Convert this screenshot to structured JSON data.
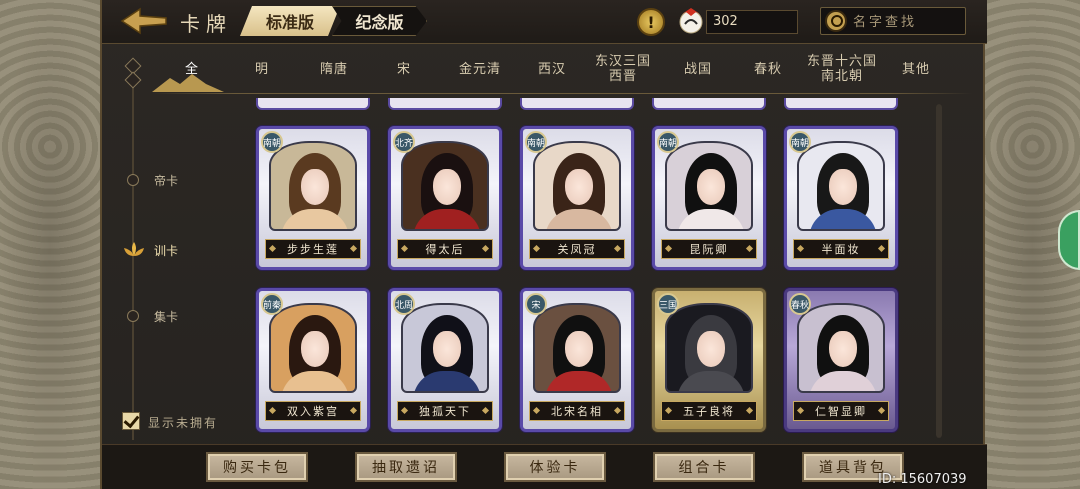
{
  "header": {
    "title": "卡牌",
    "tab_standard": "标准版",
    "tab_memorial": "纪念版",
    "currency_value": "302",
    "search_placeholder": "名字查找"
  },
  "dynasty_tabs": [
    {
      "label": "全",
      "active": true
    },
    {
      "label": "明",
      "active": false
    },
    {
      "label": "隋唐",
      "active": false
    },
    {
      "label": "宋",
      "active": false
    },
    {
      "label": "金元清",
      "active": false
    },
    {
      "label": "西汉",
      "active": false
    },
    {
      "label": "东汉三国西晋",
      "active": false
    },
    {
      "label": "战国",
      "active": false
    },
    {
      "label": "春秋",
      "active": false
    },
    {
      "label": "东晋十六国南北朝",
      "active": false
    },
    {
      "label": "其他",
      "active": false
    }
  ],
  "left_rail": {
    "items": [
      {
        "label": "帝卡",
        "active": false
      },
      {
        "label": "训卡",
        "active": true
      },
      {
        "label": "集卡",
        "active": false
      }
    ],
    "show_unowned_label": "显示未拥有",
    "show_unowned_checked": true
  },
  "cards": [
    {
      "name": "步步生莲",
      "badge": "南朝",
      "frame": "silver",
      "hair": "#5a3a20",
      "robe": "#e8c8a0",
      "bg": "#c8b898"
    },
    {
      "name": "得太后",
      "badge": "北齐",
      "frame": "silver",
      "hair": "#1a1010",
      "robe": "#a02020",
      "bg": "#4a3020"
    },
    {
      "name": "关凤冠",
      "badge": "南朝",
      "frame": "silver",
      "hair": "#3a2418",
      "robe": "#d8b8a0",
      "bg": "#e8d8c8"
    },
    {
      "name": "昆阮卿",
      "badge": "南朝",
      "frame": "silver",
      "hair": "#101010",
      "robe": "#f0e8e8",
      "bg": "#d8d0d8"
    },
    {
      "name": "半面妆",
      "badge": "南朝",
      "frame": "silver",
      "hair": "#181818",
      "robe": "#3a58a0",
      "bg": "#e8e8f0"
    },
    {
      "name": "双入紫宫",
      "badge": "前秦",
      "frame": "silver",
      "hair": "#2a1810",
      "robe": "#e8c090",
      "bg": "#d8a060"
    },
    {
      "name": "独孤天下",
      "badge": "北周",
      "frame": "silver",
      "hair": "#101018",
      "robe": "#2a3a70",
      "bg": "#c8c8d8"
    },
    {
      "name": "北宋名相",
      "badge": "宋",
      "frame": "silver",
      "hair": "#101010",
      "robe": "#b02828",
      "bg": "#6a5040"
    },
    {
      "name": "五子良将",
      "badge": "三国",
      "frame": "gold",
      "hair": "#3a3a40",
      "robe": "#4a4a50",
      "bg": "#1a1a20"
    },
    {
      "name": "仁智显卿",
      "badge": "春秋",
      "frame": "purple",
      "hair": "#101010",
      "robe": "#e0d0d8",
      "bg": "#c8c0d0"
    }
  ],
  "bottom_buttons": [
    "购买卡包",
    "抽取遗诏",
    "体验卡",
    "组合卡",
    "道具背包"
  ],
  "uid_text": "ID: 15607039",
  "colors": {
    "accent_gold": "#c8a860",
    "frame_silver": "#5a4aa8",
    "panel_bg": "#2c2824"
  },
  "icons": [
    "back-arrow-icon",
    "warning-icon",
    "crane-currency-icon",
    "search-icon",
    "lotus-icon",
    "mountain-icon"
  ]
}
